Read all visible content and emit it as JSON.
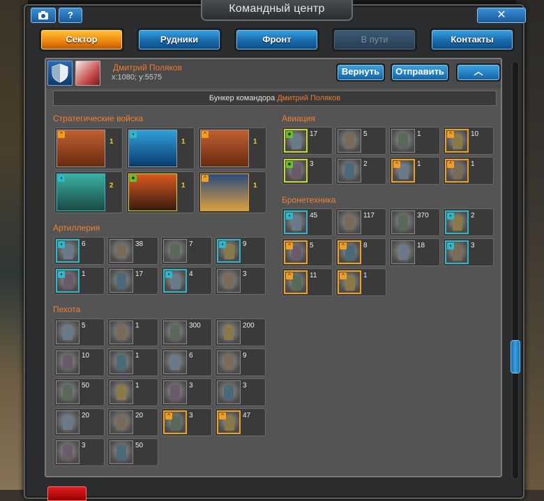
{
  "window": {
    "title": "Командный центр",
    "camera_icon": "camera-icon",
    "help_label": "?",
    "close_label": "✕"
  },
  "tabs": [
    {
      "label": "Сектор",
      "state": "active"
    },
    {
      "label": "Рудники",
      "state": "normal"
    },
    {
      "label": "Фронт",
      "state": "normal"
    },
    {
      "label": "В пути",
      "state": "disabled"
    },
    {
      "label": "Контакты",
      "state": "normal"
    }
  ],
  "player": {
    "name": "Дмитрий Поляков",
    "coords": "x:1080; y:5575",
    "buttons": {
      "return": "Вернуть",
      "send": "Отправить",
      "collapse": "︿"
    }
  },
  "bunker": {
    "prefix": "Бункер командора",
    "name": "Дмитрий Поляков"
  },
  "sections": {
    "strategic": {
      "title": "Стратегические войска",
      "counts": [
        "1",
        "1",
        "1",
        "2",
        "1",
        "1"
      ]
    },
    "artillery": {
      "title": "Артиллерия",
      "counts": [
        "6",
        "38",
        "7",
        "9",
        "1",
        "17",
        "4",
        "3"
      ]
    },
    "infantry": {
      "title": "Пехота",
      "counts": [
        "5",
        "1",
        "300",
        "200",
        "10",
        "1",
        "6",
        "9",
        "50",
        "1",
        "3",
        "3",
        "20",
        "20",
        "3",
        "47",
        "3",
        "50"
      ]
    },
    "aviation": {
      "title": "Авиация",
      "counts": [
        "17",
        "5",
        "1",
        "10",
        "3",
        "2",
        "1",
        "1"
      ]
    },
    "armor": {
      "title": "Бронетехника",
      "counts": [
        "45",
        "117",
        "370",
        "2",
        "5",
        "8",
        "18",
        "3",
        "11",
        "1"
      ]
    }
  },
  "colors": {
    "accent": "#f07830",
    "tab_active": "#f08a10",
    "tab_normal": "#1a6eb0"
  }
}
